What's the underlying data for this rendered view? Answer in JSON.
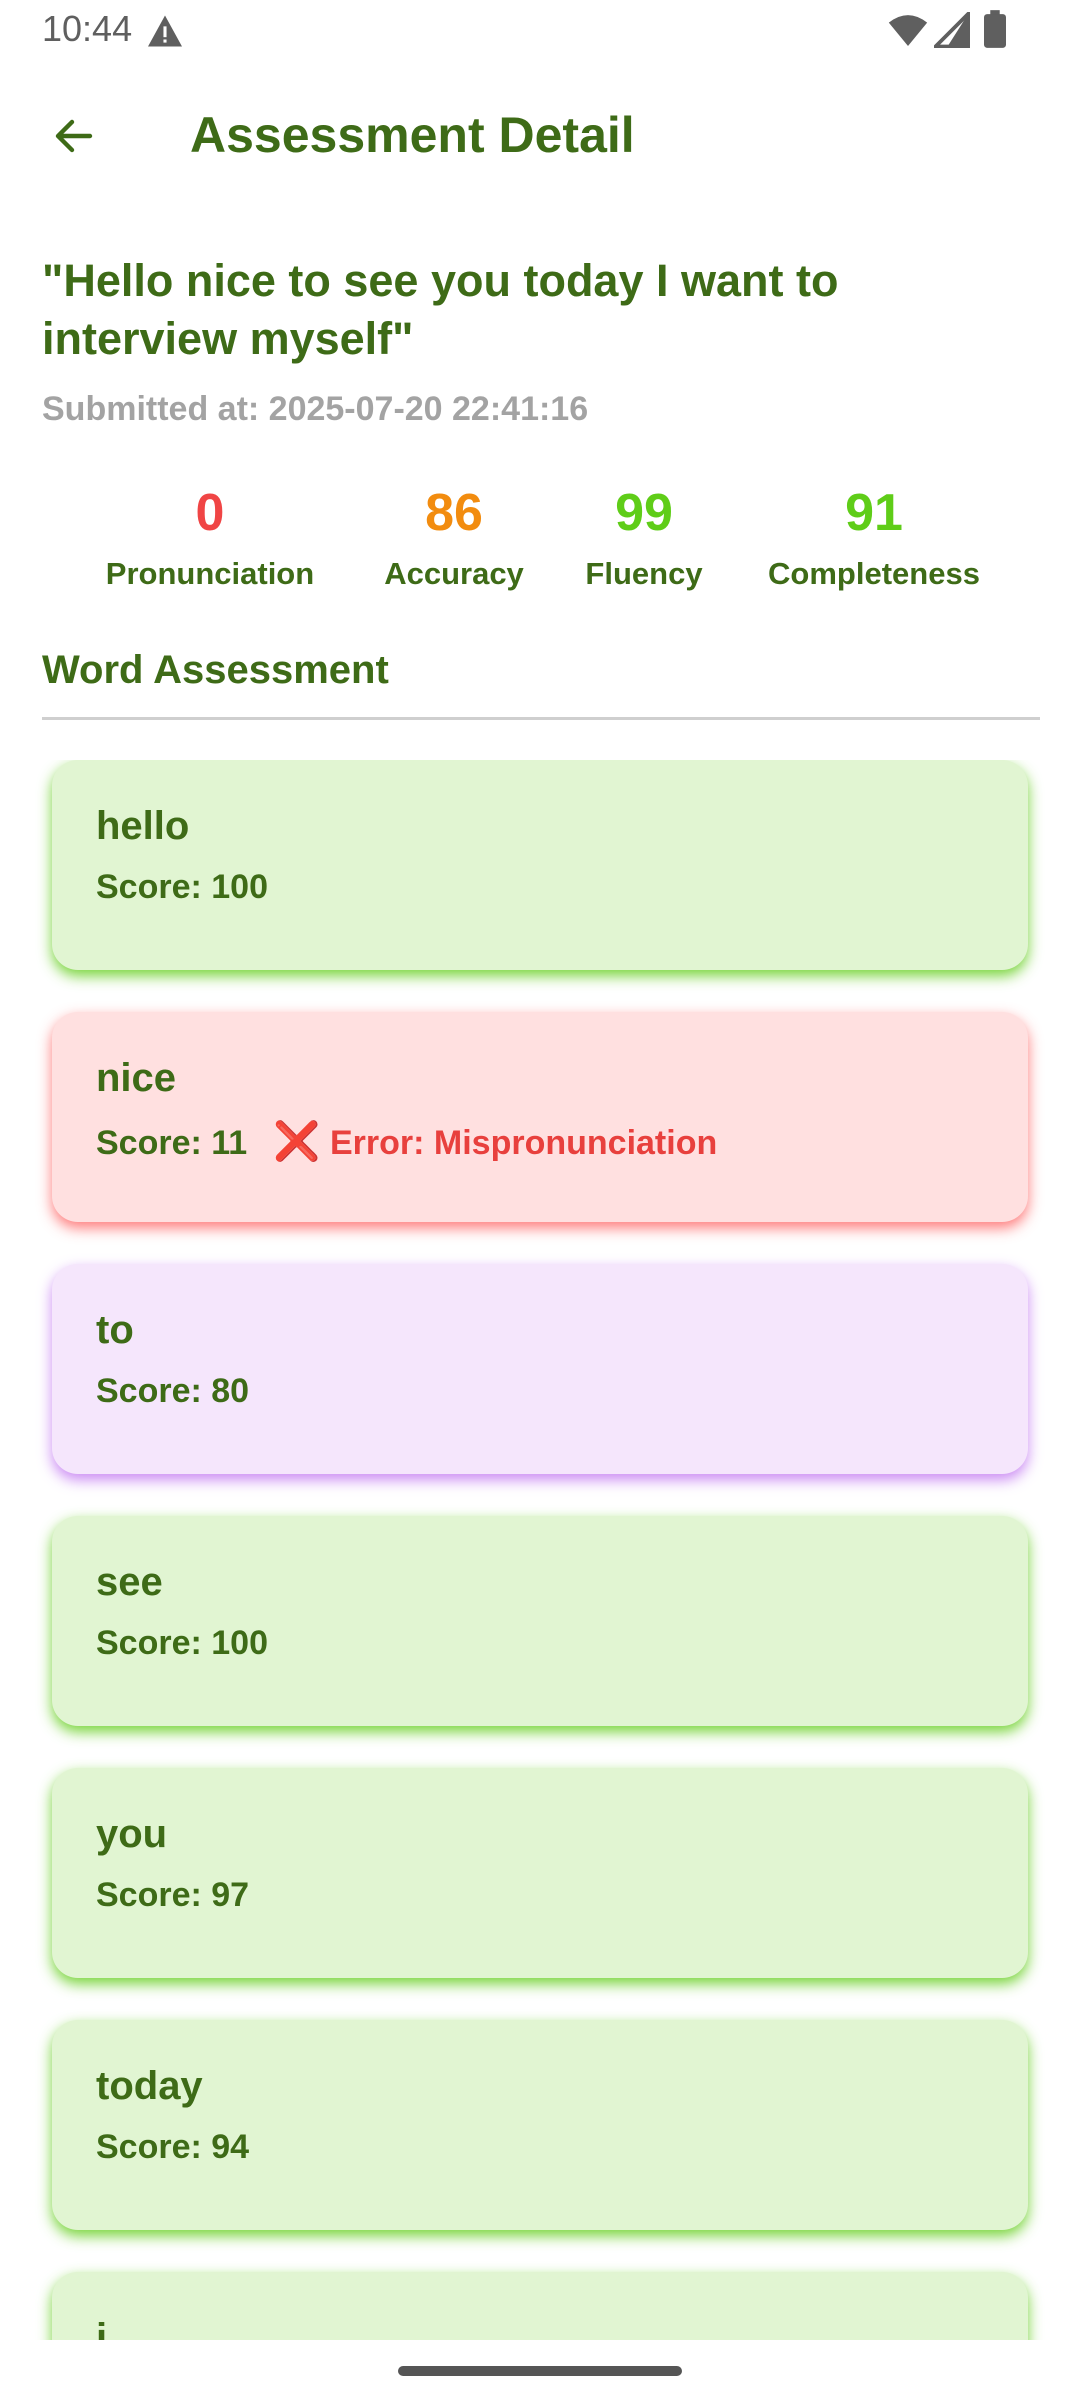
{
  "status_bar": {
    "time": "10:44"
  },
  "app_bar": {
    "title": "Assessment Detail"
  },
  "sentence": "\"Hello nice to see you today I want to interview myself\"",
  "submitted_at": "Submitted at: 2025-07-20 22:41:16",
  "scores": [
    {
      "value": "0",
      "label": "Pronunciation",
      "color": "#f04545"
    },
    {
      "value": "86",
      "label": "Accuracy",
      "color": "#f28c0f"
    },
    {
      "value": "99",
      "label": "Fluency",
      "color": "#5fcd18"
    },
    {
      "value": "91",
      "label": "Completeness",
      "color": "#5fcd18"
    }
  ],
  "word_assessment": {
    "title": "Word Assessment",
    "words": [
      {
        "word": "hello",
        "score": "Score: 100",
        "status": "good"
      },
      {
        "word": "nice",
        "score": "Score: 11",
        "status": "bad",
        "error_icon": "❌",
        "error": "Error: Mispronunciation"
      },
      {
        "word": "to",
        "score": "Score: 80",
        "status": "mid"
      },
      {
        "word": "see",
        "score": "Score: 100",
        "status": "good"
      },
      {
        "word": "you",
        "score": "Score: 97",
        "status": "good"
      },
      {
        "word": "today",
        "score": "Score: 94",
        "status": "good"
      },
      {
        "word": "i",
        "score": "",
        "status": "good"
      }
    ]
  },
  "icons": {
    "back": "arrow-back-icon",
    "warning": "warning-icon",
    "wifi": "wifi-icon",
    "signal": "signal-icon",
    "battery": "battery-icon"
  }
}
